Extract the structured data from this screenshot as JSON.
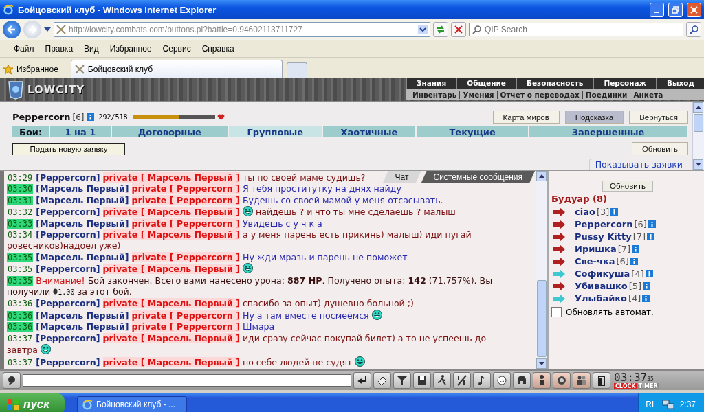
{
  "window": {
    "title": "Бойцовский клуб - Windows Internet Explorer"
  },
  "address_bar": {
    "url": "http://lowcity.combats.com/buttons.pl?battle=0.94602113711727",
    "search_placeholder": "QIP Search"
  },
  "menu": [
    "Файл",
    "Правка",
    "Вид",
    "Избранное",
    "Сервис",
    "Справка"
  ],
  "favorites": "Избранное",
  "browser_tab": "Бойцовский клуб",
  "game": {
    "logo": "LOWCITY",
    "nav_main": [
      "Знания",
      "Общение",
      "Безопасность",
      "Персонаж",
      "Выход"
    ],
    "nav_sub": [
      "Инвентарь",
      "Умения",
      "Отчет о переводах",
      "Поединки",
      "Анкета"
    ],
    "player": {
      "name": "Peppercorn",
      "rank": "[6]",
      "hp": "292/518",
      "hp_bar": {
        "level": 0.564
      }
    },
    "top_buttons": [
      {
        "label": "Карта миров",
        "selected": false
      },
      {
        "label": "Подсказка",
        "selected": true
      },
      {
        "label": "Вернуться",
        "selected": false
      }
    ],
    "battle_label": "Бои:",
    "battle_tabs": [
      {
        "label": "1 на 1",
        "selected": false
      },
      {
        "label": "Договорные",
        "selected": false
      },
      {
        "label": "Групповые",
        "selected": true
      },
      {
        "label": "Хаотичные",
        "selected": false
      },
      {
        "label": "Текущие",
        "selected": false
      },
      {
        "label": "Завершенные",
        "selected": false
      }
    ],
    "new_request_button": "Подать новую заявку",
    "refresh_button": "Обновить",
    "show_requests_link": "Показывать заявки",
    "chat": {
      "tabs": [
        {
          "label": "Чат",
          "selected": true
        },
        {
          "label": "Системные сообщения",
          "selected": false
        }
      ],
      "messages": [
        {
          "kind": "sent",
          "time": "03:29",
          "highlighted": false,
          "from": "[Peppercorn]",
          "to": "private [ Марсель Первый ]",
          "text": "ты по своей маме судишь?",
          "smiley_before": false,
          "smiley_after": false
        },
        {
          "kind": "received",
          "time": "03:30",
          "highlighted": true,
          "from": "[Марсель Первый]",
          "to": "private [ Peppercorn ]",
          "text": "Я тебя проститутку на днях найду",
          "smiley_before": false,
          "smiley_after": false
        },
        {
          "kind": "received",
          "time": "03:31",
          "highlighted": true,
          "from": "[Марсель Первый]",
          "to": "private [ Peppercorn ]",
          "text": "Будешь со своей мамой у меня отсасывать.",
          "smiley_before": false,
          "smiley_after": false
        },
        {
          "kind": "sent",
          "time": "03:32",
          "highlighted": false,
          "from": "[Peppercorn]",
          "to": "private [ Марсель Первый ]",
          "text": "найдешь ? и что ты мне сделаешь ? малыш",
          "smiley_before": true,
          "smiley_after": false
        },
        {
          "kind": "received",
          "time": "03:33",
          "highlighted": true,
          "from": "[Марсель Первый]",
          "to": "private [ Peppercorn ]",
          "text": "Увидешь с у ч к а",
          "smiley_before": false,
          "smiley_after": false
        },
        {
          "kind": "sent",
          "time": "03:34",
          "highlighted": false,
          "from": "[Peppercorn]",
          "to": "private [ Марсель Первый ]",
          "text": "а у меня парень есть прикинь) малыш) иди пугай",
          "continuation": "ровесников)надоел уже)",
          "smiley_before": false,
          "smiley_after": false
        },
        {
          "kind": "received",
          "time": "03:35",
          "highlighted": true,
          "from": "[Марсель Первый]",
          "to": "private [ Peppercorn ]",
          "text": "Ну жди мразь и парень не поможет",
          "smiley_before": false,
          "smiley_after": false
        },
        {
          "kind": "sent",
          "time": "03:35",
          "highlighted": false,
          "from": "[Peppercorn]",
          "to": "private [ Марсель Первый ]",
          "smiley_before": false,
          "smiley_after": true
        },
        {
          "kind": "system",
          "time": "03:35",
          "highlighted": true,
          "label": "Внимание!",
          "text": "Бой закончен. Всего вами нанесено урона: **887 HP**. Получено опыта: **142** (71.757%). Вы",
          "continuation": "получили",
          "amount": "1.00",
          "text_after": "за этот бой."
        },
        {
          "kind": "sent",
          "time": "03:36",
          "highlighted": false,
          "from": "[Peppercorn]",
          "to": "private [ Марсель Первый ]",
          "text": "спасибо за опыт) душевно больной ;)",
          "smiley_before": false,
          "smiley_after": false
        },
        {
          "kind": "received",
          "time": "03:36",
          "highlighted": true,
          "from": "[Марсель Первый]",
          "to": "private [ Peppercorn ]",
          "text": "Ну а там вместе посмеёмся",
          "smiley_before": false,
          "smiley_after": true
        },
        {
          "kind": "received",
          "time": "03:36",
          "highlighted": true,
          "from": "[Марсель Первый]",
          "to": "private [ Peppercorn ]",
          "text": "Шмара",
          "smiley_before": false,
          "smiley_after": false
        },
        {
          "kind": "sent",
          "time": "03:37",
          "highlighted": false,
          "from": "[Peppercorn]",
          "to": "private [ Марсель Первый ]",
          "text": "иди сразу сейчас покупай билет) а то не успеешь до",
          "continuation": "завтра",
          "smiley_before": false,
          "smiley_after": true
        },
        {
          "kind": "sent",
          "time": "03:37",
          "highlighted": false,
          "from": "[Peppercorn]",
          "to": "private [ Марсель Первый ]",
          "text": "по себе людей не судят",
          "smiley_before": false,
          "smiley_after": true
        }
      ]
    },
    "sidebar": {
      "refresh_button": "Обновить",
      "room_title": "Будуар (8)",
      "users": [
        {
          "name": "ciao",
          "rank": "[3]",
          "color": "#b02020"
        },
        {
          "name": "Peppercorn",
          "rank": "[6]",
          "color": "#b02020"
        },
        {
          "name": "Pussy Kitty",
          "rank": "[7]",
          "color": "#b02020"
        },
        {
          "name": "Иришка",
          "rank": "[7]",
          "color": "#b02020"
        },
        {
          "name": "Све-чка",
          "rank": "[6]",
          "color": "#b02020"
        },
        {
          "name": "Софикуша",
          "rank": "[4]",
          "color": "#40c8d0"
        },
        {
          "name": "Убивашко",
          "rank": "[5]",
          "color": "#b02020"
        },
        {
          "name": "Улыбайко",
          "rank": "[4]",
          "color": "#40c8d0"
        }
      ],
      "auto_refresh": {
        "label": "Обновлять автомат.",
        "checked": false
      }
    },
    "clock": {
      "time": "03:37",
      "seconds": "35",
      "clock_label": "CLOCK",
      "timer_label": "TIMER"
    }
  },
  "taskbar": {
    "start": "пуск",
    "task": "Бойцовский клуб - ...",
    "language": "RL",
    "time": "2:37"
  }
}
